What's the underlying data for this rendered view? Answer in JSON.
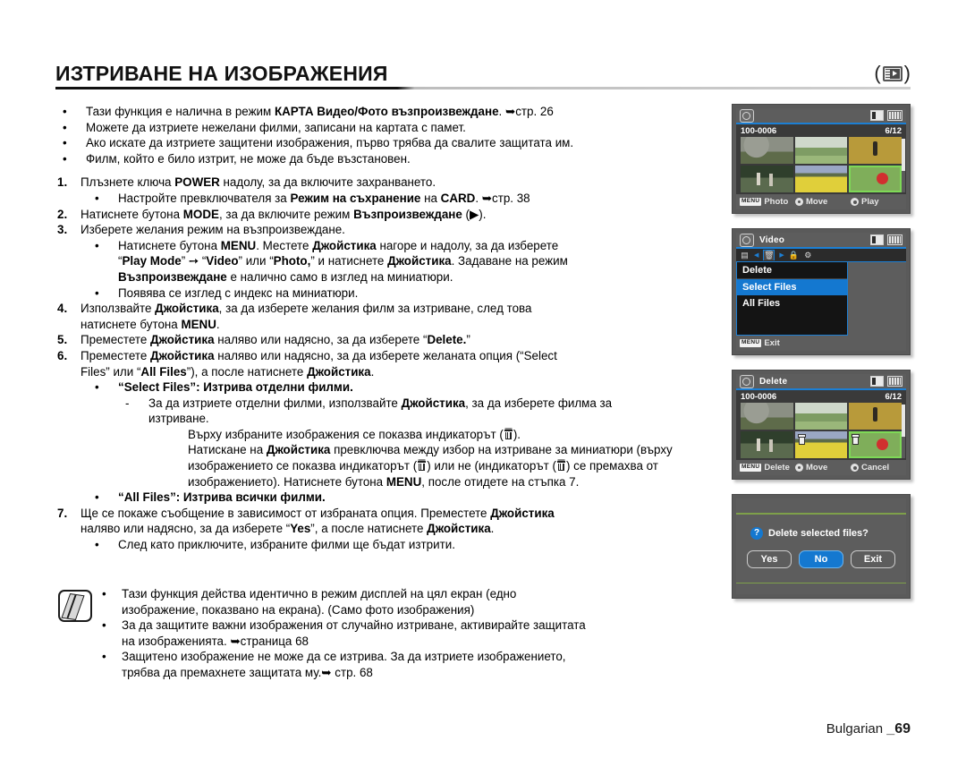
{
  "header": {
    "title": "ИЗТРИВАНЕ НА ИЗОБРАЖЕНИЯ",
    "mode_icon": "card-playback-icon"
  },
  "intro_bullets": [
    "Тази функция е налична в режим КАРТА Видео/Фото възпроизвеждане. ➥стр. 26",
    "Можете да изтриете нежелани филми, записани на картата с памет.",
    "Ако искате да изтриете защитени изображения, първо трябва да свалите защитата им.",
    "Филм, който е било изтрит, не може да бъде възстановен."
  ],
  "steps": {
    "s1": {
      "num": "1.",
      "text": "Плъзнете ключа POWER надолу, за да включите захранването.",
      "sub": "Настройте превключвателя за Режим на съхранение на CARD. ➥стр. 38"
    },
    "s2": {
      "num": "2.",
      "text": "Натиснете бутона MODE, за да включите режим Възпроизвеждане (▶)."
    },
    "s3": {
      "num": "3.",
      "text": "Изберете желания режим на възпроизвеждане.",
      "sub1_a": "Натиснете бутона MENU. Местете Джойстика нагоре и надолу, за да изберете",
      "sub1_b": "“Play Mode” ➙ “Video” или “Photo,”  и натиснете Джойстика. Задаване на режим",
      "sub1_c": "Възпроизвеждане е налично само в изглед на миниатюри.",
      "sub2": "Появява се изглед с индекс на миниатюри."
    },
    "s4": {
      "num": "4.",
      "text_a": "Използвайте Джойстика, за да изберете желания филм за изтриване, след това",
      "text_b": "натиснете бутона MENU."
    },
    "s5": {
      "num": "5.",
      "text": "Преместете Джойстика наляво или надясно, за да изберете “Delete.”"
    },
    "s6": {
      "num": "6.",
      "text_a": "Преместете Джойстика наляво или надясно, за да изберете желаната опция (“Select",
      "text_b": "Files” или “All Files”), а после натиснете Джойстика.",
      "select_files_label": "“Select Files”: Изтрива отделни филми.",
      "dash_a": "За да изтриете отделни филми, използвайте Джойстика, за да изберете филма за",
      "dash_b": "изтриване.",
      "cont_1": "Върху избраните изображения се показва индикаторът (",
      "cont_1_end": ").",
      "cont_2": "Натискане на Джойстика превключва между избор на изтриване за миниатюри (върху",
      "cont_3_a": "изображението се показва индикаторът (",
      "cont_3_b": ") или не (индикаторът (",
      "cont_3_c": ") се премахва от",
      "cont_4": "изображението). Натиснете бутона MENU, после отидете на стъпка 7.",
      "all_files_label": "“All Files”: Изтрива всички филми."
    },
    "s7": {
      "num": "7.",
      "text_a": "Ще се покаже съобщение в зависимост от избраната опция. Преместете Джойстика",
      "text_b": "наляво или надясно, за да изберете “Yes”, а после натиснете Джойстика.",
      "sub": "След като приключите, избраните филми ще бъдат изтрити."
    }
  },
  "notes": {
    "icon": "note-pencil-icon",
    "items": [
      {
        "line_a": "Тази функция действа идентично в режим дисплей на цял екран (едно",
        "line_b": "изображение, показвано на екрана). (Само фото изображения)"
      },
      {
        "line_a": "За да защитите важни изображения от случайно изтриване, активирайте защитата",
        "line_b": "на изображенията. ➥страница 68"
      },
      {
        "line_a": "Защитено изображение не може да се изтрива. За да изтриете изображението,",
        "line_b": "трябва да премахнете защитата му.➥ стр. 68"
      }
    ]
  },
  "footer": {
    "language": "Bulgarian",
    "page": "_69"
  },
  "screenshots": {
    "shot1": {
      "name": "thumbnail-index-view",
      "file_label": "100-0006",
      "counter": "6/12",
      "bottom": {
        "menu_chip": "MENU",
        "menu_action": "Photo",
        "move_label": "Move",
        "play_label": "Play"
      }
    },
    "shot2": {
      "name": "delete-menu",
      "title": "Video",
      "menu_head": "Delete",
      "items": [
        {
          "label": "Select Files",
          "selected": true
        },
        {
          "label": "All Files",
          "selected": false
        }
      ],
      "bottom": {
        "menu_chip": "MENU",
        "exit_label": "Exit"
      }
    },
    "shot3": {
      "name": "delete-selection-view",
      "title": "Delete",
      "file_label": "100-0006",
      "counter": "6/12",
      "bottom": {
        "menu_chip": "MENU",
        "menu_action": "Delete",
        "move_label": "Move",
        "cancel_label": "Cancel"
      }
    },
    "shot4": {
      "name": "delete-confirm-dialog",
      "question_icon": "?",
      "message": "Delete selected files?",
      "buttons": [
        {
          "label": "Yes",
          "selected": false
        },
        {
          "label": "No",
          "selected": true
        },
        {
          "label": "Exit",
          "selected": false
        }
      ]
    }
  },
  "colors": {
    "accent_blue": "#1478d0",
    "lcd_bg": "#5d5d5d",
    "select_green": "#7ed957"
  }
}
